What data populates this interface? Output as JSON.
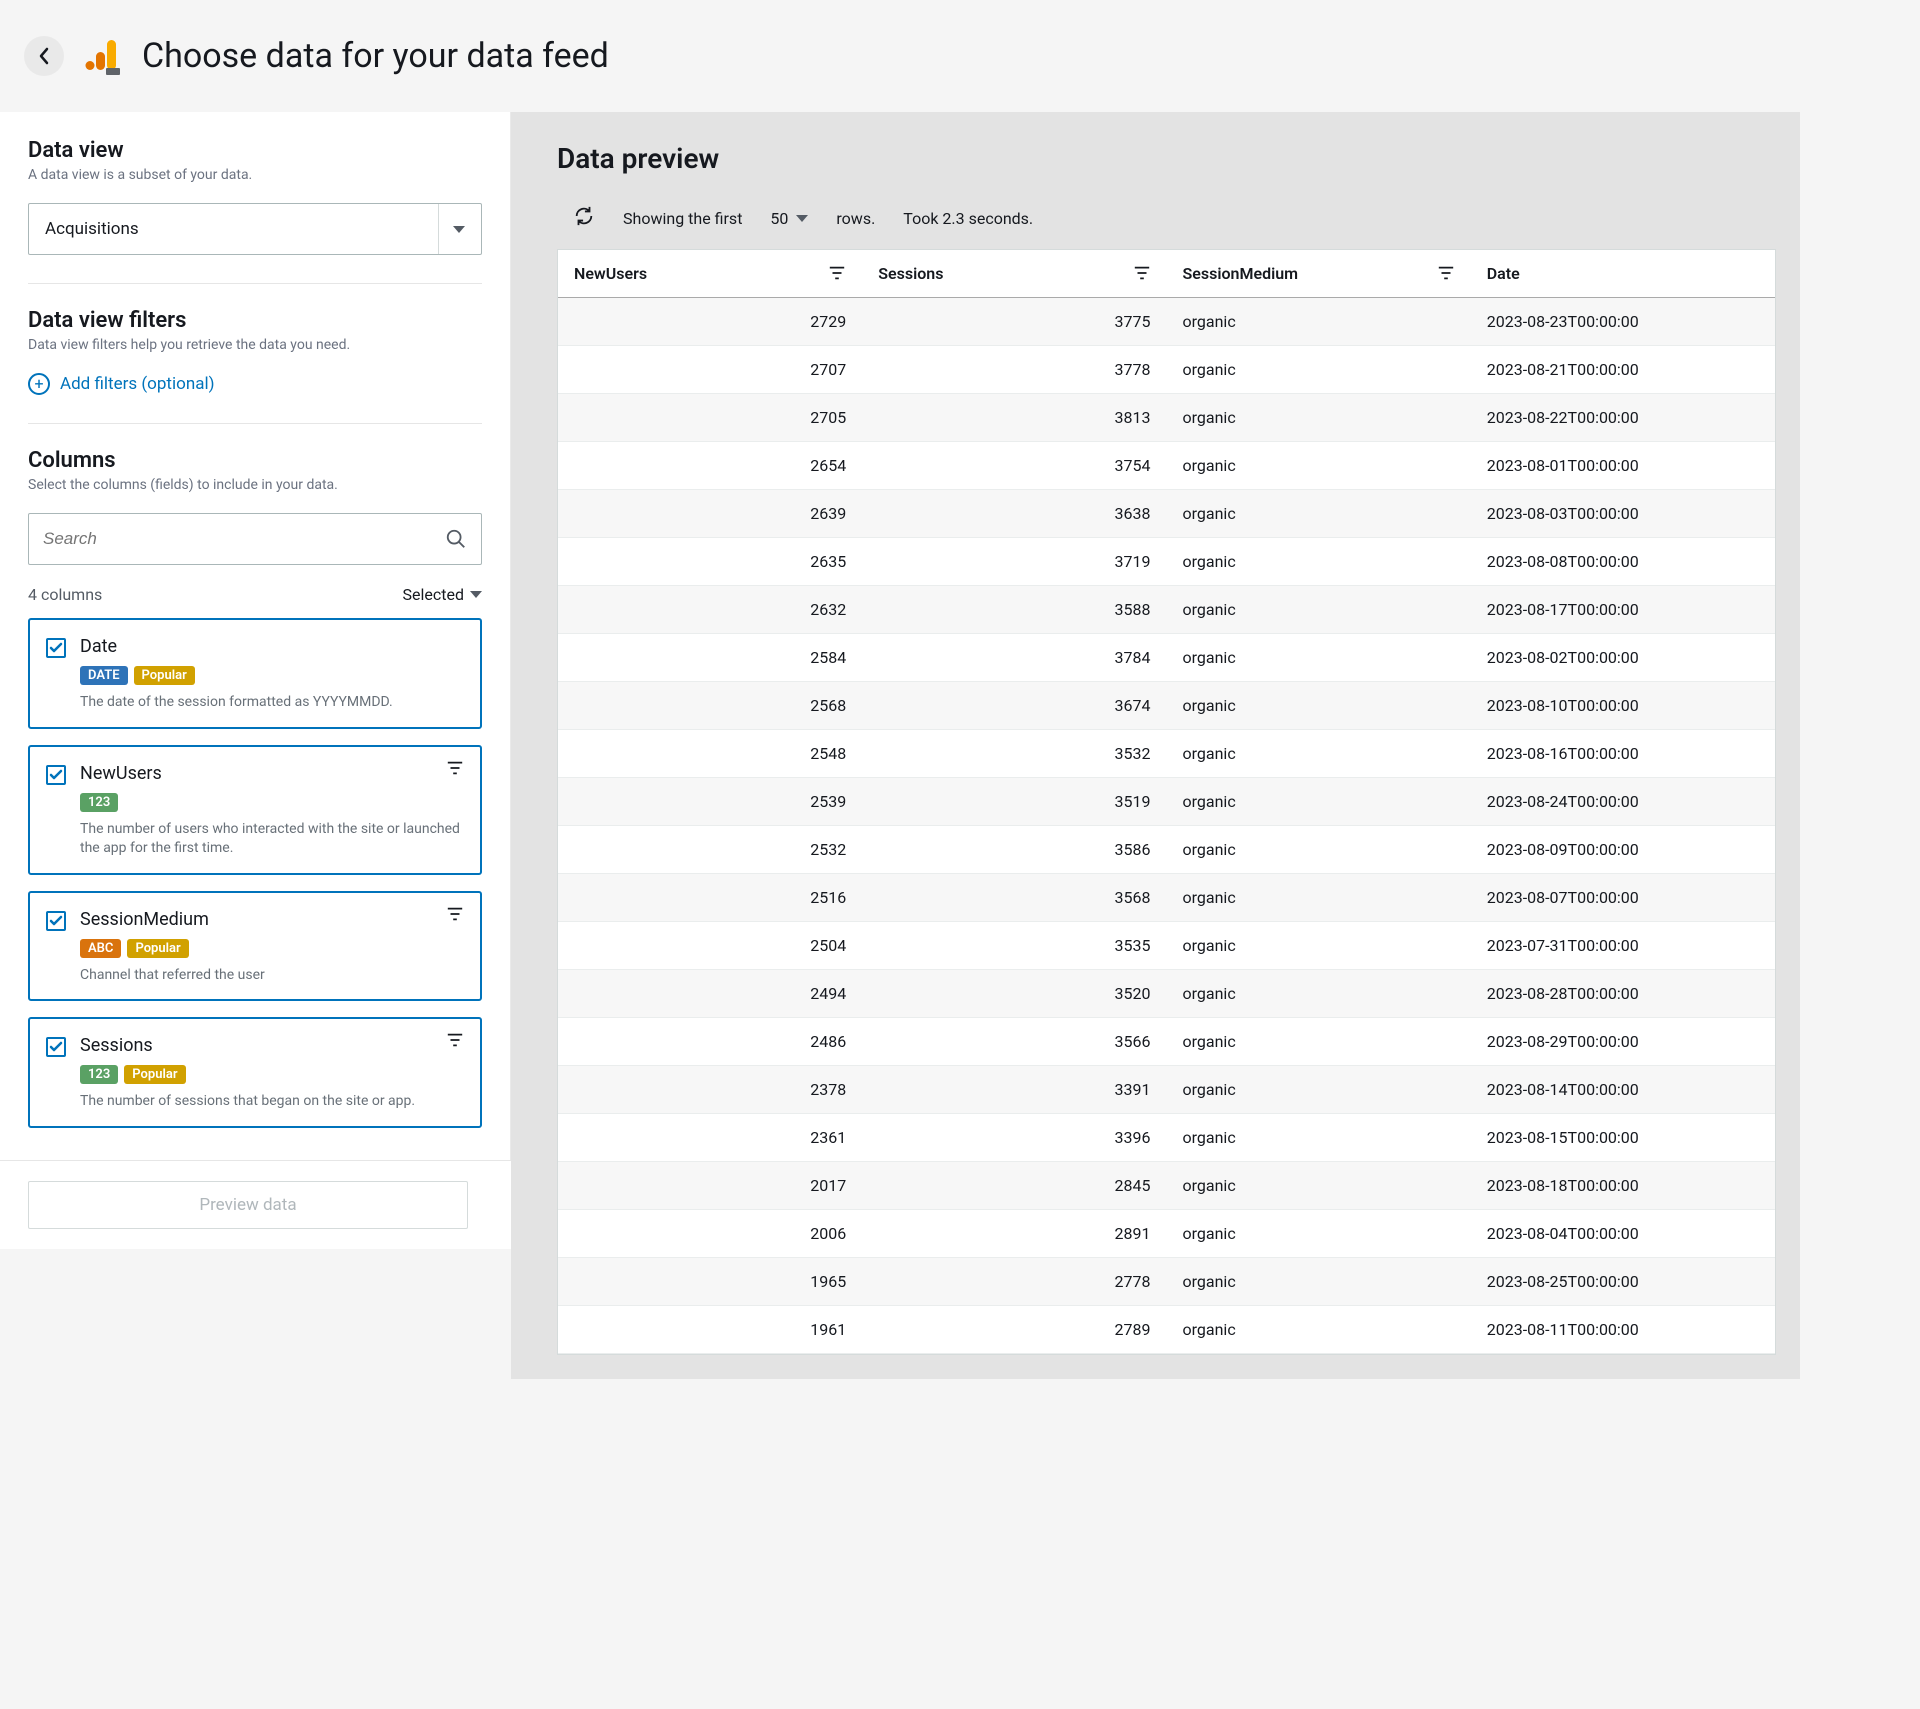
{
  "header": {
    "title": "Choose data for your data feed"
  },
  "dataView": {
    "title": "Data view",
    "desc": "A data view is a subset of your data.",
    "selected": "Acquisitions"
  },
  "filters": {
    "title": "Data view filters",
    "desc": "Data view filters help you retrieve the data you need.",
    "addLabel": "Add filters (optional)"
  },
  "columns": {
    "title": "Columns",
    "desc": "Select the columns (fields) to include in your data.",
    "searchPlaceholder": "Search",
    "countLabel": "4 columns",
    "selectedLabel": "Selected",
    "items": [
      {
        "name": "Date",
        "badges": [
          {
            "label": "DATE",
            "cls": "badge-date"
          },
          {
            "label": "Popular",
            "cls": "badge-popular"
          }
        ],
        "desc": "The date of the session formatted as YYYYMMDD.",
        "hasFilter": false
      },
      {
        "name": "NewUsers",
        "badges": [
          {
            "label": "123",
            "cls": "badge-123"
          }
        ],
        "desc": "The number of users who interacted with the site or launched the app for the first time.",
        "hasFilter": true
      },
      {
        "name": "SessionMedium",
        "badges": [
          {
            "label": "ABC",
            "cls": "badge-abc"
          },
          {
            "label": "Popular",
            "cls": "badge-popular"
          }
        ],
        "desc": "Channel that referred the user",
        "hasFilter": true
      },
      {
        "name": "Sessions",
        "badges": [
          {
            "label": "123",
            "cls": "badge-123"
          },
          {
            "label": "Popular",
            "cls": "badge-popular"
          }
        ],
        "desc": "The number of sessions that began on the site or app.",
        "hasFilter": true
      }
    ]
  },
  "previewBtn": "Preview data",
  "preview": {
    "title": "Data preview",
    "showingLabel": "Showing the first",
    "rowCount": "50",
    "rowsSuffix": "rows.",
    "timing": "Took 2.3 seconds.",
    "headers": [
      "NewUsers",
      "Sessions",
      "SessionMedium",
      "Date"
    ],
    "rows": [
      {
        "newUsers": "2729",
        "sessions": "3775",
        "medium": "organic",
        "date": "2023-08-23T00:00:00"
      },
      {
        "newUsers": "2707",
        "sessions": "3778",
        "medium": "organic",
        "date": "2023-08-21T00:00:00"
      },
      {
        "newUsers": "2705",
        "sessions": "3813",
        "medium": "organic",
        "date": "2023-08-22T00:00:00"
      },
      {
        "newUsers": "2654",
        "sessions": "3754",
        "medium": "organic",
        "date": "2023-08-01T00:00:00"
      },
      {
        "newUsers": "2639",
        "sessions": "3638",
        "medium": "organic",
        "date": "2023-08-03T00:00:00"
      },
      {
        "newUsers": "2635",
        "sessions": "3719",
        "medium": "organic",
        "date": "2023-08-08T00:00:00"
      },
      {
        "newUsers": "2632",
        "sessions": "3588",
        "medium": "organic",
        "date": "2023-08-17T00:00:00"
      },
      {
        "newUsers": "2584",
        "sessions": "3784",
        "medium": "organic",
        "date": "2023-08-02T00:00:00"
      },
      {
        "newUsers": "2568",
        "sessions": "3674",
        "medium": "organic",
        "date": "2023-08-10T00:00:00"
      },
      {
        "newUsers": "2548",
        "sessions": "3532",
        "medium": "organic",
        "date": "2023-08-16T00:00:00"
      },
      {
        "newUsers": "2539",
        "sessions": "3519",
        "medium": "organic",
        "date": "2023-08-24T00:00:00"
      },
      {
        "newUsers": "2532",
        "sessions": "3586",
        "medium": "organic",
        "date": "2023-08-09T00:00:00"
      },
      {
        "newUsers": "2516",
        "sessions": "3568",
        "medium": "organic",
        "date": "2023-08-07T00:00:00"
      },
      {
        "newUsers": "2504",
        "sessions": "3535",
        "medium": "organic",
        "date": "2023-07-31T00:00:00"
      },
      {
        "newUsers": "2494",
        "sessions": "3520",
        "medium": "organic",
        "date": "2023-08-28T00:00:00"
      },
      {
        "newUsers": "2486",
        "sessions": "3566",
        "medium": "organic",
        "date": "2023-08-29T00:00:00"
      },
      {
        "newUsers": "2378",
        "sessions": "3391",
        "medium": "organic",
        "date": "2023-08-14T00:00:00"
      },
      {
        "newUsers": "2361",
        "sessions": "3396",
        "medium": "organic",
        "date": "2023-08-15T00:00:00"
      },
      {
        "newUsers": "2017",
        "sessions": "2845",
        "medium": "organic",
        "date": "2023-08-18T00:00:00"
      },
      {
        "newUsers": "2006",
        "sessions": "2891",
        "medium": "organic",
        "date": "2023-08-04T00:00:00"
      },
      {
        "newUsers": "1965",
        "sessions": "2778",
        "medium": "organic",
        "date": "2023-08-25T00:00:00"
      },
      {
        "newUsers": "1961",
        "sessions": "2789",
        "medium": "organic",
        "date": "2023-08-11T00:00:00"
      }
    ]
  }
}
